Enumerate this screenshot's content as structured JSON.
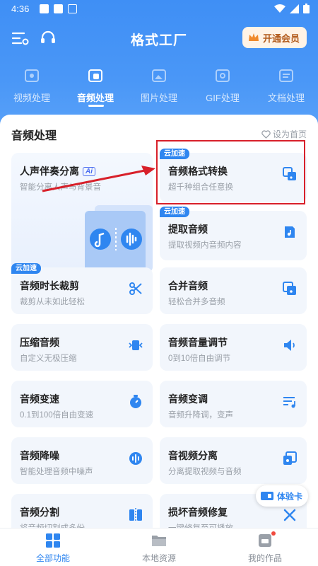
{
  "status_bar": {
    "time": "4:36"
  },
  "header": {
    "title": "格式工厂",
    "vip_label": "开通会员"
  },
  "tabs": [
    {
      "label": "视频处理",
      "icon": "video-icon",
      "active": false
    },
    {
      "label": "音频处理",
      "icon": "audio-icon",
      "active": true
    },
    {
      "label": "图片处理",
      "icon": "image-icon",
      "active": false
    },
    {
      "label": "GIF处理",
      "icon": "gif-icon",
      "active": false
    },
    {
      "label": "文档处理",
      "icon": "document-icon",
      "active": false
    }
  ],
  "section": {
    "title": "音频处理",
    "set_home": "设为首页"
  },
  "featured": {
    "title": "人声伴奏分离",
    "ai_tag": "Ai",
    "subtitle": "智能分离人声与背景音"
  },
  "badge_text": "云加速",
  "cards": [
    {
      "title": "音频格式转换",
      "subtitle": "超千种组合任意换",
      "icon": "audio-convert-icon",
      "badge": true
    },
    {
      "title": "提取音频",
      "subtitle": "提取视频内音频内容",
      "icon": "extract-audio-icon",
      "badge": true
    },
    {
      "title": "音频时长裁剪",
      "subtitle": "裁剪从未如此轻松",
      "icon": "scissors-icon",
      "badge": true
    },
    {
      "title": "合并音频",
      "subtitle": "轻松合并多音频",
      "icon": "merge-audio-icon",
      "badge": false
    },
    {
      "title": "压缩音频",
      "subtitle": "自定义无极压缩",
      "icon": "compress-audio-icon",
      "badge": false
    },
    {
      "title": "音频音量调节",
      "subtitle": "0到10倍自由调节",
      "icon": "volume-icon",
      "badge": false
    },
    {
      "title": "音频变速",
      "subtitle": "0.1到100倍自由变速",
      "icon": "speed-icon",
      "badge": false
    },
    {
      "title": "音频变调",
      "subtitle": "音频升降调，变声",
      "icon": "pitch-icon",
      "badge": false
    },
    {
      "title": "音频降噪",
      "subtitle": "智能处理音频中噪声",
      "icon": "denoise-icon",
      "badge": false
    },
    {
      "title": "音视频分离",
      "subtitle": "分离提取视频与音频",
      "icon": "av-split-icon",
      "badge": false
    },
    {
      "title": "音频分割",
      "subtitle": "将音频切割成多份",
      "icon": "split-audio-icon",
      "badge": false
    },
    {
      "title": "损坏音频修复",
      "subtitle": "一键修复至可播放",
      "icon": "repair-audio-icon",
      "badge": false
    }
  ],
  "trial_card": "体验卡",
  "bottom_nav": [
    {
      "label": "全部功能",
      "icon": "grid-icon",
      "active": true
    },
    {
      "label": "本地资源",
      "icon": "folder-icon",
      "active": false
    },
    {
      "label": "我的作品",
      "icon": "works-icon",
      "active": false
    }
  ],
  "colors": {
    "primary": "#2f86f0",
    "header": "#4a97f7",
    "highlight": "#d8202a"
  }
}
